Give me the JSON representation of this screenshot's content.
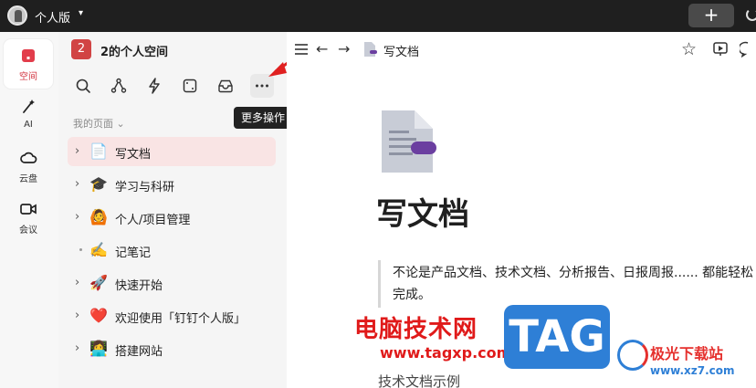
{
  "topbar": {
    "title": "个人版",
    "caret": "▾",
    "plus": "+"
  },
  "rail": {
    "items": [
      {
        "label": "空间",
        "icon": "space-icon",
        "active": true
      },
      {
        "label": "AI",
        "icon": "ai-wand-icon"
      },
      {
        "label": "云盘",
        "icon": "cloud-icon"
      },
      {
        "label": "会议",
        "icon": "video-icon"
      }
    ]
  },
  "sidebar": {
    "space_badge": "2",
    "space_title": "2的个人空间",
    "tooltip": "更多操作",
    "section_label": "我的页面 ⌄",
    "items": [
      {
        "label": "写文档",
        "emoji": "📄",
        "selected": true,
        "chevron": "›"
      },
      {
        "label": "学习与科研",
        "emoji": "🎓",
        "chevron": "›"
      },
      {
        "label": "个人/项目管理",
        "emoji": "🙆",
        "chevron": "›"
      },
      {
        "label": "记笔记",
        "emoji": "✍️",
        "dot": true
      },
      {
        "label": "快速开始",
        "emoji": "🚀",
        "chevron": "›"
      },
      {
        "label": "欢迎使用「钉钉个人版」",
        "emoji": "❤️",
        "chevron": "›"
      },
      {
        "label": "搭建网站",
        "emoji": "👩‍💻",
        "chevron": "›"
      }
    ]
  },
  "main": {
    "breadcrumb_title": "写文档",
    "back": "←",
    "forward": "→",
    "star": "☆",
    "doc_title": "写文档",
    "quote_text": "不论是产品文档、技术文档、分析报告、日报周报...... 都能轻松完成。",
    "faded_line": "技术文档示例"
  },
  "watermarks": {
    "site_cn": "电脑技术网",
    "site_url": "www.tagxp.com",
    "tag": "TAG",
    "site2_cn": "极光下载站",
    "site2_url": "www.xz7.com"
  },
  "colors": {
    "accent": "#d2333f",
    "selected_bg": "#f9e4e4",
    "topbar": "#1f1f1f"
  }
}
